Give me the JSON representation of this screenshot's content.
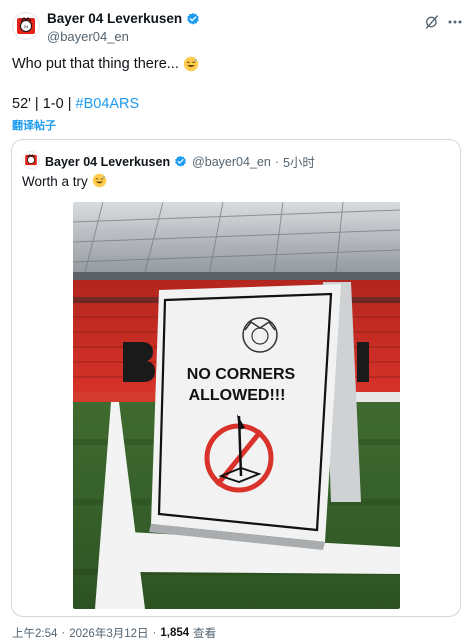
{
  "tweet": {
    "display_name": "Bayer 04 Leverkusen",
    "handle": "@bayer04_en",
    "text": "Who put that thing there...",
    "score_prefix": "52' | 1-0 | ",
    "hashtag": "#B04ARS",
    "translate_label": "翻译帖子"
  },
  "quote": {
    "display_name": "Bayer 04 Leverkusen",
    "handle": "@bayer04_en",
    "separator": "·",
    "time": "5小时",
    "text": "Worth a try"
  },
  "photo": {
    "sign_line1": "NO CORNERS",
    "sign_line2": "ALLOWED!!!"
  },
  "footer": {
    "time": "上午2:54",
    "separator1": "·",
    "date": "2026年3月12日",
    "separator2": "·",
    "views_count": "1,854",
    "views_label": "查看"
  },
  "colors": {
    "accent": "#1d9bf0",
    "brand_red": "#e32219",
    "secondary_text": "#536471"
  },
  "icons": {
    "verified": "verified-badge-icon",
    "grok": "grok-icon",
    "more": "more-icon",
    "emoji": "sweat-smile-emoji-icon"
  }
}
